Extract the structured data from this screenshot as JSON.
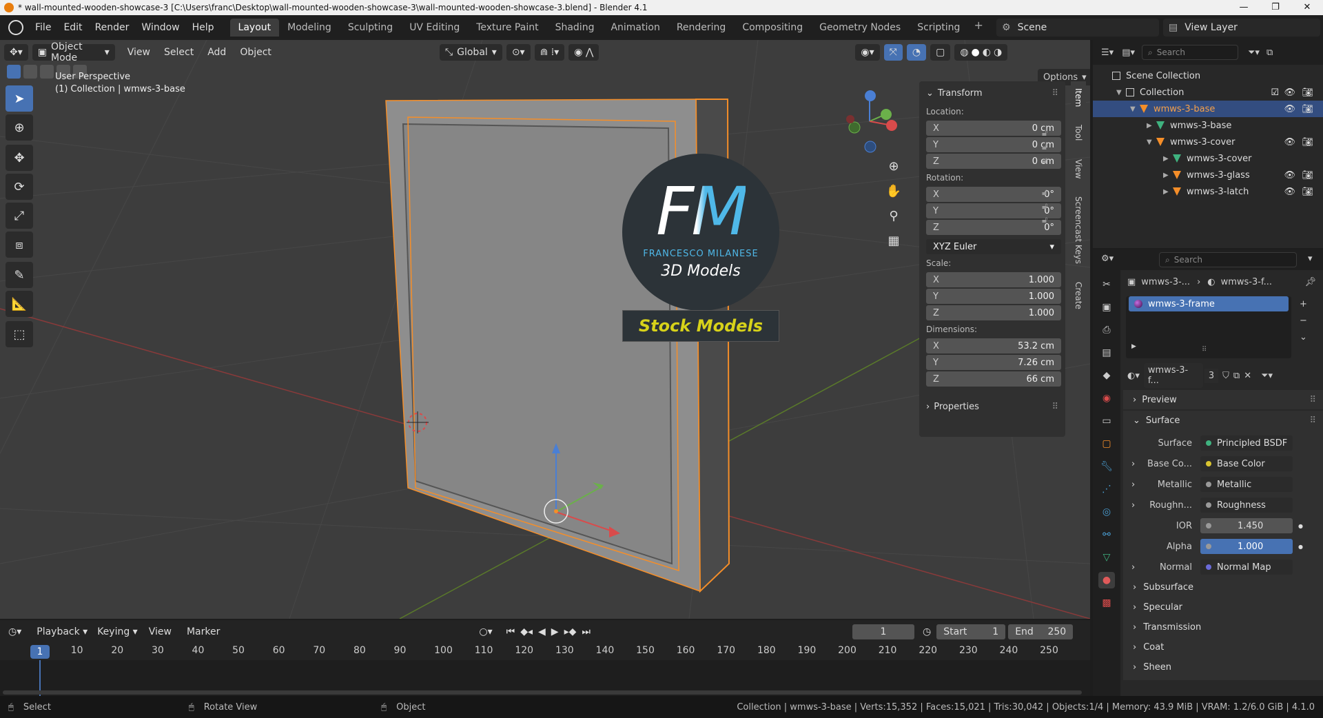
{
  "titlebar": {
    "title": "* wall-mounted-wooden-showcase-3 [C:\\Users\\franc\\Desktop\\wall-mounted-wooden-showcase-3\\wall-mounted-wooden-showcase-3.blend] - Blender 4.1",
    "minimize": "—",
    "maximize": "❐",
    "close": "✕"
  },
  "menu": {
    "items": [
      "File",
      "Edit",
      "Render",
      "Window",
      "Help"
    ]
  },
  "workspaces": [
    "Layout",
    "Modeling",
    "Sculpting",
    "UV Editing",
    "Texture Paint",
    "Shading",
    "Animation",
    "Rendering",
    "Compositing",
    "Geometry Nodes",
    "Scripting"
  ],
  "workspace_add": "+",
  "scene": {
    "label": "Scene",
    "view_layer": "View Layer"
  },
  "viewport": {
    "mode": "Object Mode",
    "menus": [
      "View",
      "Select",
      "Add",
      "Object"
    ],
    "orientation": "Global",
    "options": "Options",
    "info_line1": "User Perspective",
    "info_line2": "(1) Collection | wmws-3-base",
    "watermark": {
      "logo": "FM",
      "author": "FRANCESCO MILANESE",
      "tagline": "3D Models",
      "banner": "Stock Models"
    }
  },
  "transform": {
    "title": "Transform",
    "location_label": "Location:",
    "location": [
      {
        "ax": "X",
        "v": "0 cm"
      },
      {
        "ax": "Y",
        "v": "0 cm"
      },
      {
        "ax": "Z",
        "v": "0 cm"
      }
    ],
    "rotation_label": "Rotation:",
    "rotation": [
      {
        "ax": "X",
        "v": "0°"
      },
      {
        "ax": "Y",
        "v": "0°"
      },
      {
        "ax": "Z",
        "v": "0°"
      }
    ],
    "rotation_mode": "XYZ Euler",
    "scale_label": "Scale:",
    "scale": [
      {
        "ax": "X",
        "v": "1.000"
      },
      {
        "ax": "Y",
        "v": "1.000"
      },
      {
        "ax": "Z",
        "v": "1.000"
      }
    ],
    "dimensions_label": "Dimensions:",
    "dimensions": [
      {
        "ax": "X",
        "v": "53.2 cm"
      },
      {
        "ax": "Y",
        "v": "7.26 cm"
      },
      {
        "ax": "Z",
        "v": "66 cm"
      }
    ],
    "properties_label": "Properties"
  },
  "sidetabs": [
    "Item",
    "Tool",
    "View",
    "Screencast Keys",
    "Create"
  ],
  "outliner": {
    "search_placeholder": "Search",
    "rows": [
      {
        "label": "Scene Collection",
        "indent": 0
      },
      {
        "label": "Collection",
        "indent": 1
      },
      {
        "label": "wmws-3-base",
        "indent": 2
      },
      {
        "label": "wmws-3-base",
        "indent": 3
      },
      {
        "label": "wmws-3-cover",
        "indent": 3
      },
      {
        "label": "wmws-3-cover",
        "indent": 4
      },
      {
        "label": "wmws-3-glass",
        "indent": 4
      },
      {
        "label": "wmws-3-latch",
        "indent": 4
      }
    ]
  },
  "properties": {
    "search_placeholder": "Search",
    "breadcrumb_obj": "wmws-3-...",
    "breadcrumb_mat": "wmws-3-f...",
    "material_slot": "wmws-3-frame",
    "material_name": "wmws-3-f...",
    "material_users": "3",
    "preview": "Preview",
    "surface_section": "Surface",
    "surface_label": "Surface",
    "surface_value": "Principled BSDF",
    "inputs": [
      {
        "label": "Base Co...",
        "value": "Base Color"
      },
      {
        "label": "Metallic",
        "value": "Metallic"
      },
      {
        "label": "Roughn...",
        "value": "Roughness"
      },
      {
        "label": "IOR",
        "value": "1.450"
      },
      {
        "label": "Alpha",
        "value": "1.000"
      },
      {
        "label": "Normal",
        "value": "Normal Map"
      }
    ],
    "subsections": [
      "Subsurface",
      "Specular",
      "Transmission",
      "Coat",
      "Sheen"
    ]
  },
  "timeline": {
    "menus": [
      "Playback",
      "Keying",
      "View",
      "Marker"
    ],
    "current_frame": "1",
    "start_label": "Start",
    "start": "1",
    "end_label": "End",
    "end": "250",
    "ticks": [
      "1",
      "10",
      "20",
      "30",
      "40",
      "50",
      "60",
      "70",
      "80",
      "90",
      "100",
      "110",
      "120",
      "130",
      "140",
      "150",
      "160",
      "170",
      "180",
      "190",
      "200",
      "210",
      "220",
      "230",
      "240",
      "250"
    ]
  },
  "statusbar": {
    "select": "Select",
    "rotate": "Rotate View",
    "object": "Object",
    "stats": "Collection | wmws-3-base | Verts:15,352 | Faces:15,021 | Tris:30,042 | Objects:1/4 | Memory: 43.9 MiB | VRAM: 1.2/6.0 GiB | 4.1.0"
  },
  "colors": {
    "accent": "#4772b3",
    "selection_orange": "#f58e29",
    "active_row": "#334d80"
  }
}
